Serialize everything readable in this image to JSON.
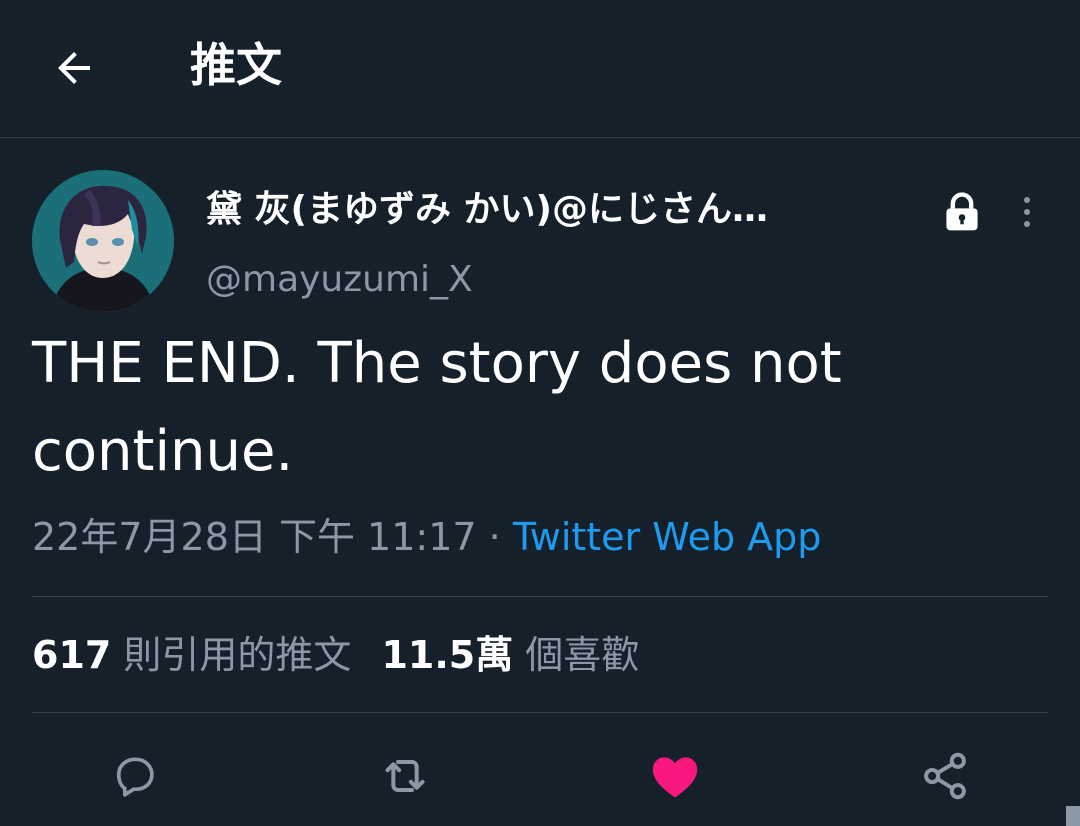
{
  "header": {
    "title": "推文",
    "back_icon": "arrow-left-icon"
  },
  "tweet": {
    "display_name": "黛 灰(まゆずみ かい)@にじさん…",
    "handle": "@mayuzumi_X",
    "protected_icon": "lock-icon",
    "more_icon": "more-vertical-icon",
    "text": "THE END. The story does not continue.",
    "timestamp": "22年7月28日 下午 11:17",
    "separator": " · ",
    "source": "Twitter Web App"
  },
  "stats": {
    "quotes_count": "617",
    "quotes_label": "則引用的推文",
    "likes_count": "11.5萬",
    "likes_label": "個喜歡"
  },
  "actions": {
    "reply_icon": "reply-icon",
    "retweet_icon": "retweet-icon",
    "like_icon": "heart-icon",
    "share_icon": "share-icon"
  },
  "colors": {
    "background": "#15202b",
    "accent_link": "#1d9bf0",
    "liked": "#f91880",
    "muted": "#8b98a5",
    "divider": "#38444d"
  }
}
